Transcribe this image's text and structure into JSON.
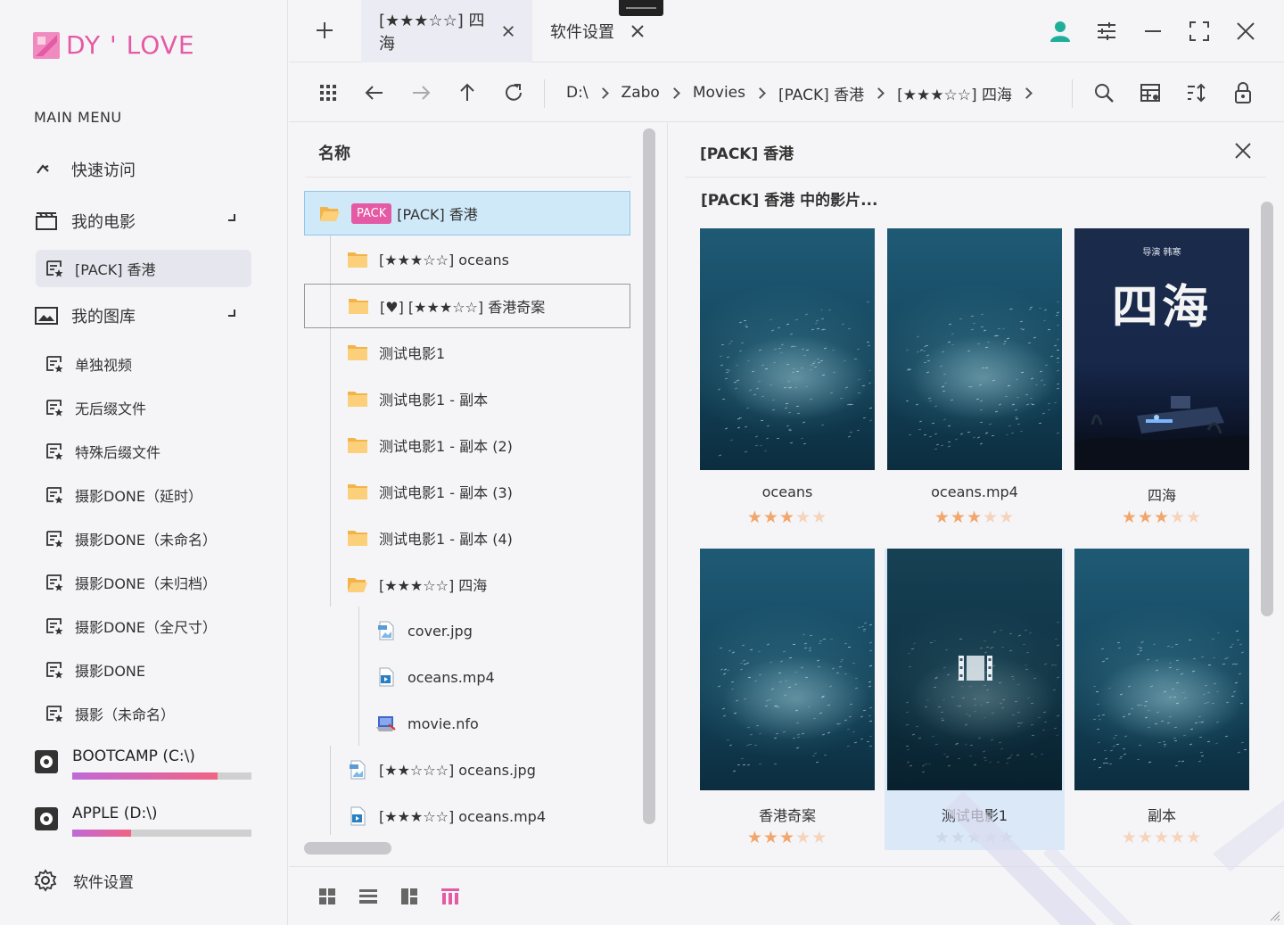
{
  "app": {
    "logo_text": "DY ' LOVE",
    "accent": "#e55aa4"
  },
  "sidebar": {
    "heading": "MAIN MENU",
    "quick_access": "快速访问",
    "my_movies": "我的电影",
    "my_movies_items": [
      "[PACK] 香港"
    ],
    "my_gallery": "我的图库",
    "gallery_items": [
      "单独视频",
      "无后缀文件",
      "特殊后缀文件",
      "摄影DONE（延时）",
      "摄影DONE（未命名）",
      "摄影DONE（未归档）",
      "摄影DONE（全尺寸）",
      "摄影DONE",
      "摄影（未命名）"
    ],
    "drives": [
      {
        "label": "BOOTCAMP  (C:\\)",
        "used": 0.81
      },
      {
        "label": "APPLE  (D:\\)",
        "used": 0.33
      }
    ],
    "settings": "软件设置"
  },
  "tabs": [
    {
      "label": "[★★★☆☆] 四海",
      "active": true
    },
    {
      "label": "软件设置",
      "active": false
    }
  ],
  "breadcrumb": [
    "D:\\",
    "Zabo",
    "Movies",
    "[PACK] 香港",
    "[★★★☆☆] 四海"
  ],
  "tree": {
    "header": "名称",
    "pack_badge": "PACK",
    "rows": [
      {
        "label": "[PACK] 香港",
        "type": "folder-open",
        "level": 0,
        "state": "selected",
        "badge": true
      },
      {
        "label": "[★★★☆☆] oceans",
        "type": "folder",
        "level": 1
      },
      {
        "label": "[♥] [★★★☆☆] 香港奇案",
        "type": "folder",
        "level": 1,
        "state": "outlined"
      },
      {
        "label": "测试电影1",
        "type": "folder",
        "level": 1
      },
      {
        "label": "测试电影1 - 副本",
        "type": "folder",
        "level": 1
      },
      {
        "label": "测试电影1 - 副本 (2)",
        "type": "folder",
        "level": 1
      },
      {
        "label": "测试电影1 - 副本 (3)",
        "type": "folder",
        "level": 1
      },
      {
        "label": "测试电影1 - 副本 (4)",
        "type": "folder",
        "level": 1
      },
      {
        "label": "[★★★☆☆] 四海",
        "type": "folder-open",
        "level": 1
      },
      {
        "label": "cover.jpg",
        "type": "image",
        "level": 2
      },
      {
        "label": "oceans.mp4",
        "type": "video",
        "level": 2
      },
      {
        "label": "movie.nfo",
        "type": "nfo",
        "level": 2
      },
      {
        "label": "[★★☆☆☆] oceans.jpg",
        "type": "image",
        "level": 1
      },
      {
        "label": "[★★★☆☆] oceans.mp4",
        "type": "video",
        "level": 1
      }
    ]
  },
  "detail": {
    "title": "[PACK] 香港",
    "subtitle": "[PACK] 香港 中的影片...",
    "cards": [
      {
        "label": "oceans",
        "rating": 3,
        "poster": "ocean"
      },
      {
        "label": "oceans.mp4",
        "rating": 3,
        "poster": "ocean"
      },
      {
        "label": "四海",
        "rating": 3,
        "poster": "sihai",
        "poster_text": "四海",
        "poster_small": "导演 韩寒"
      },
      {
        "label": "香港奇案",
        "rating": 3,
        "poster": "ocean"
      },
      {
        "label": "测试电影1",
        "rating": 0,
        "poster": "ocean-dark",
        "highlight": true
      },
      {
        "label": "副本",
        "rating": 0,
        "poster": "ocean"
      }
    ]
  }
}
